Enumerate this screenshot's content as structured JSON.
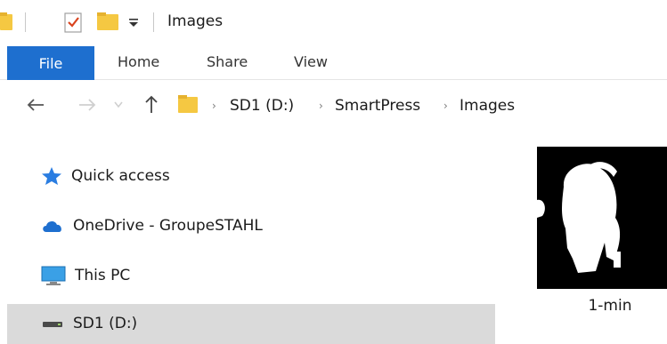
{
  "window": {
    "title": "Images"
  },
  "ribbon": {
    "tabs": [
      {
        "label": "File",
        "active": true
      },
      {
        "label": "Home"
      },
      {
        "label": "Share"
      },
      {
        "label": "View"
      }
    ]
  },
  "address": {
    "crumbs": [
      "SD1 (D:)",
      "SmartPress",
      "Images"
    ]
  },
  "navpane": {
    "items": [
      {
        "label": "Quick access",
        "icon": "star-icon"
      },
      {
        "label": "OneDrive - GroupeSTAHL",
        "icon": "cloud-icon"
      },
      {
        "label": "This PC",
        "icon": "monitor-icon"
      },
      {
        "label": "SD1 (D:)",
        "icon": "drive-icon",
        "selected": true
      }
    ]
  },
  "files": [
    {
      "name": "1-min"
    }
  ],
  "colors": {
    "accent": "#1e6fcf",
    "folder": "#f5c842",
    "star": "#2a7de1",
    "cloud": "#1e6fcf",
    "selection": "#dadada"
  }
}
